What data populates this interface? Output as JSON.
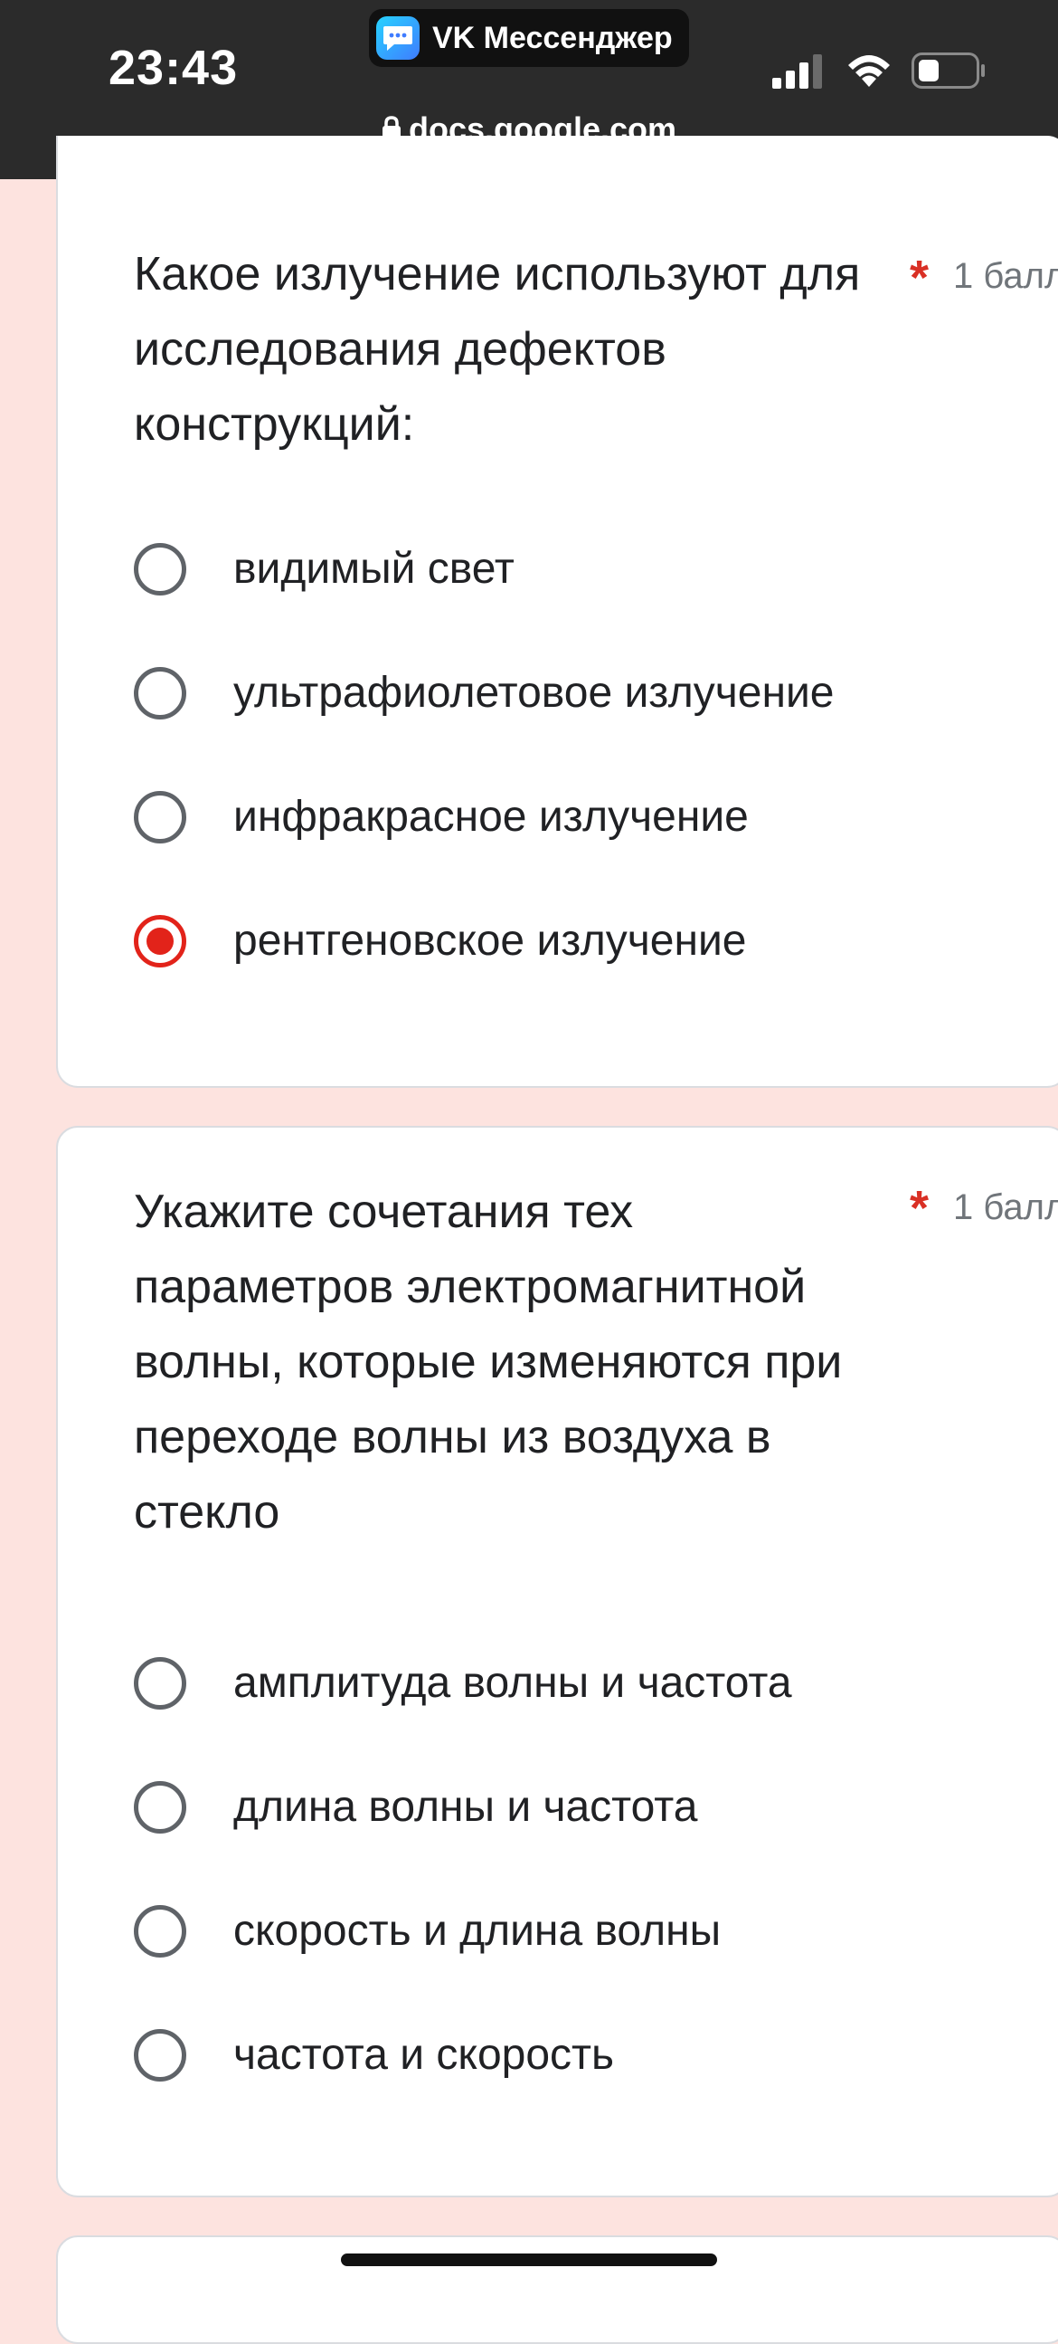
{
  "status_bar": {
    "time": "23:43",
    "app_name": "VK Мессенджер",
    "url": "docs.google.com"
  },
  "colors": {
    "accent": "#e2231a",
    "required": "#d93025",
    "page_background": "#fde3df"
  },
  "questions": [
    {
      "title": "Какое излучение используют для исследования дефектов конструкций:",
      "required_mark": "*",
      "points": "1 балл",
      "options": [
        {
          "label": "видимый свет",
          "selected": false
        },
        {
          "label": "ультрафиолетовое излучение",
          "selected": false
        },
        {
          "label": "инфракрасное излучение",
          "selected": false
        },
        {
          "label": "рентгеновское излучение",
          "selected": true
        }
      ]
    },
    {
      "title": "Укажите сочетания тех параметров электромагнитной волны, которые изменяются при переходе волны из воздуха в стекло",
      "required_mark": "*",
      "points": "1 балл",
      "options": [
        {
          "label": "амплитуда волны и частота",
          "selected": false
        },
        {
          "label": "длина волны и частота",
          "selected": false
        },
        {
          "label": "скорость и длина волны",
          "selected": false
        },
        {
          "label": "частота и скорость",
          "selected": false
        }
      ]
    }
  ]
}
